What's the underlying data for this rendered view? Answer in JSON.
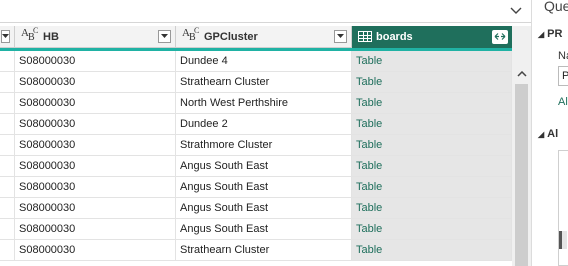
{
  "pane": {
    "title": "Que",
    "section1": "PR",
    "field_label": "Na",
    "field_value": "P",
    "link": "Al",
    "section2": "Al"
  },
  "columns": [
    {
      "type": "ABC",
      "label": "HB"
    },
    {
      "type": "ABC",
      "label": "GPCluster"
    },
    {
      "type": "table",
      "label": "boards"
    }
  ],
  "rows": [
    {
      "hb": "S08000030",
      "gp": "Dundee 4",
      "boards": "Table"
    },
    {
      "hb": "S08000030",
      "gp": "Strathearn Cluster",
      "boards": "Table"
    },
    {
      "hb": "S08000030",
      "gp": "North West Perthshire",
      "boards": "Table"
    },
    {
      "hb": "S08000030",
      "gp": "Dundee 2",
      "boards": "Table"
    },
    {
      "hb": "S08000030",
      "gp": "Strathmore Cluster",
      "boards": "Table"
    },
    {
      "hb": "S08000030",
      "gp": "Angus South East",
      "boards": "Table"
    },
    {
      "hb": "S08000030",
      "gp": "Angus South East",
      "boards": "Table"
    },
    {
      "hb": "S08000030",
      "gp": "Angus South East",
      "boards": "Table"
    },
    {
      "hb": "S08000030",
      "gp": "Angus South East",
      "boards": "Table"
    },
    {
      "hb": "S08000030",
      "gp": "Strathearn Cluster",
      "boards": "Table"
    }
  ]
}
